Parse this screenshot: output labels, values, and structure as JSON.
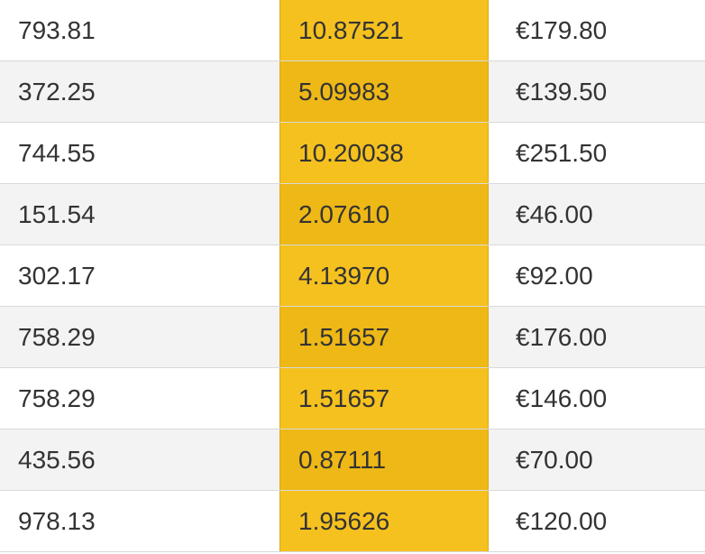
{
  "rows": [
    {
      "c1": "793.81",
      "c2": "10.87521",
      "c3": "€179.80"
    },
    {
      "c1": "372.25",
      "c2": "5.09983",
      "c3": "€139.50"
    },
    {
      "c1": "744.55",
      "c2": "10.20038",
      "c3": "€251.50"
    },
    {
      "c1": "151.54",
      "c2": "2.07610",
      "c3": "€46.00"
    },
    {
      "c1": "302.17",
      "c2": "4.13970",
      "c3": "€92.00"
    },
    {
      "c1": "758.29",
      "c2": "1.51657",
      "c3": "€176.00"
    },
    {
      "c1": "758.29",
      "c2": "1.51657",
      "c3": "€146.00"
    },
    {
      "c1": "435.56",
      "c2": "0.87111",
      "c3": "€70.00"
    },
    {
      "c1": "978.13",
      "c2": "1.95626",
      "c3": "€120.00"
    }
  ]
}
